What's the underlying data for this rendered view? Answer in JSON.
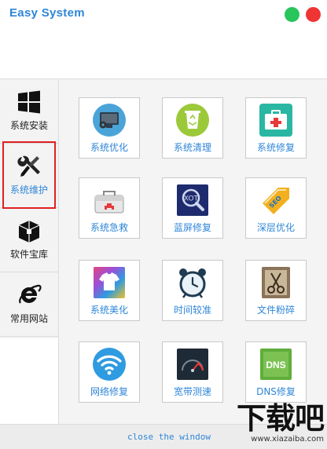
{
  "window": {
    "title": "Easy System",
    "min_color": "#27c55a",
    "close_color": "#ef3434"
  },
  "sidebar": {
    "items": [
      {
        "label": "系统安装",
        "icon": "windows-logo-icon"
      },
      {
        "label": "系统维护",
        "icon": "wrench-screwdriver-icon",
        "selected": true
      },
      {
        "label": "软件宝库",
        "icon": "package-box-icon"
      },
      {
        "label": "常用网站",
        "icon": "internet-explorer-icon"
      }
    ]
  },
  "tools": [
    {
      "label": "系统优化",
      "icon": "monitor-gear-icon"
    },
    {
      "label": "系统清理",
      "icon": "recycle-bin-icon"
    },
    {
      "label": "系统修复",
      "icon": "first-aid-kit-icon"
    },
    {
      "label": "系统急救",
      "icon": "toolbox-icon"
    },
    {
      "label": "蓝屏修复",
      "icon": "magnifier-xp-icon"
    },
    {
      "label": "深层优化",
      "icon": "seo-tag-icon"
    },
    {
      "label": "系统美化",
      "icon": "tshirt-icon"
    },
    {
      "label": "时间较准",
      "icon": "alarm-clock-icon"
    },
    {
      "label": "文件粉碎",
      "icon": "scissors-file-icon"
    },
    {
      "label": "网络修复",
      "icon": "wifi-icon"
    },
    {
      "label": "宽带测速",
      "icon": "speedometer-icon"
    },
    {
      "label": "DNS修复",
      "icon": "dns-icon"
    }
  ],
  "footer": {
    "close_label": "close the window"
  },
  "watermark": {
    "title": "下载吧",
    "url": "www.xiazaiba.com"
  },
  "accent": "#2f86d8"
}
